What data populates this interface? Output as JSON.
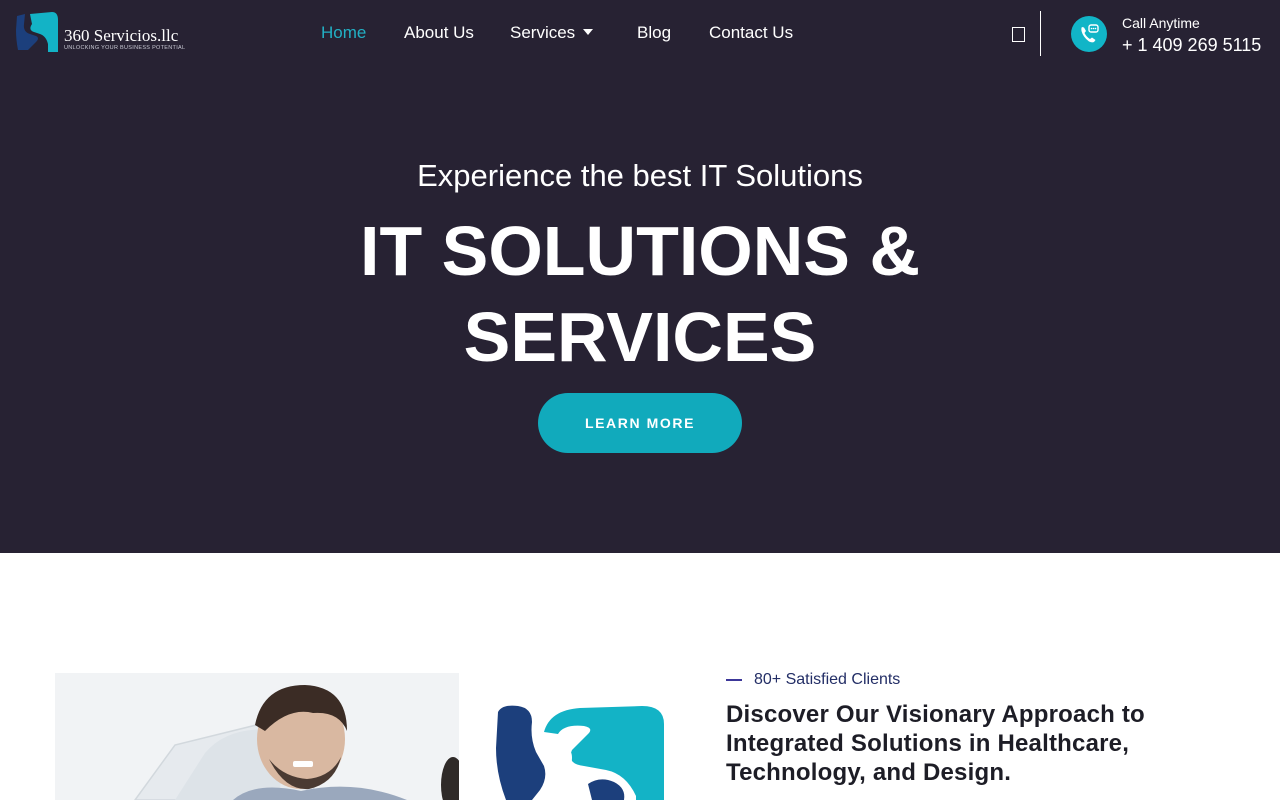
{
  "header": {
    "logo_text": "360 Servicios.llc",
    "logo_tagline": "UNLOCKING YOUR BUSINESS POTENTIAL",
    "call_label": "Call Anytime",
    "call_number": "+ 1 409 269 5115"
  },
  "nav": {
    "items": [
      {
        "label": "Home",
        "active": true
      },
      {
        "label": "About Us"
      },
      {
        "label": "Services",
        "has_dropdown": true
      },
      {
        "label": "Blog"
      },
      {
        "label": "Contact Us"
      }
    ]
  },
  "hero": {
    "subtitle": "Experience the best IT Solutions",
    "title": "IT SOLUTIONS & SERVICES",
    "button_label": "LEARN MORE"
  },
  "about": {
    "eyebrow": "80+ Satisfied Clients",
    "heading": "Discover Our Visionary Approach to Integrated Solutions in Healthcare, Technology, and Design."
  },
  "icons": [
    "logo-mark-icon",
    "chevron-down-icon",
    "search-icon",
    "phone-chat-icon"
  ],
  "colors": {
    "hero_bg": "#272233",
    "accent": "#11aabc",
    "nav_active": "#22b0c4",
    "logo_navy": "#1c3f7c",
    "heading_dark": "#1d1d26"
  }
}
